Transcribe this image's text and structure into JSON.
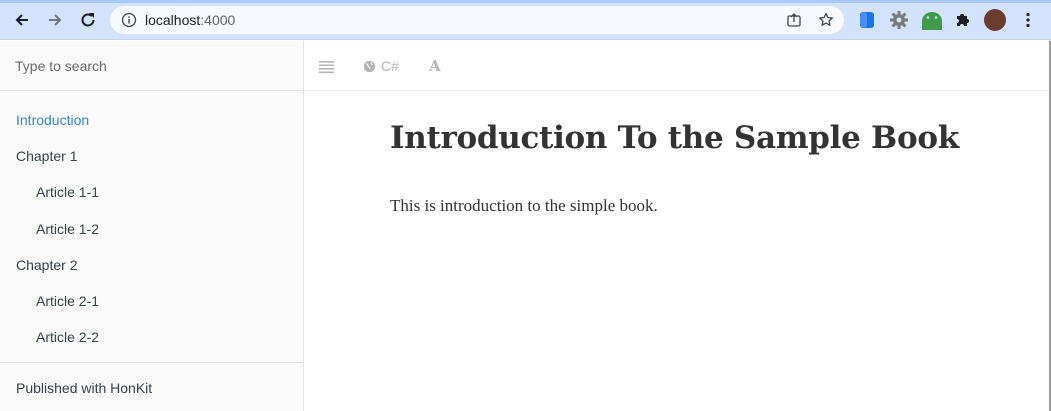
{
  "browser": {
    "url_host": "localhost",
    "url_port": ":4000",
    "icons": {
      "back": "arrow-left-icon",
      "forward": "arrow-right-icon",
      "reload": "reload-icon",
      "info": "info-icon",
      "share": "share-icon",
      "bookmark": "star-icon"
    },
    "extensions": [
      "blue-extension-icon",
      "gear-extension-icon",
      "android-extension-icon",
      "puzzle-icon",
      "profile-avatar",
      "kebab-menu-icon"
    ],
    "colors": {
      "chrome_bg": "#d3e3fd",
      "omnibox_bg": "#f6f9fe"
    }
  },
  "sidebar": {
    "search_placeholder": "Type to search",
    "items": [
      {
        "label": "Introduction",
        "level": 0,
        "active": true
      },
      {
        "label": "Chapter 1",
        "level": 0,
        "active": false
      },
      {
        "label": "Article 1-1",
        "level": 1,
        "active": false
      },
      {
        "label": "Article 1-2",
        "level": 1,
        "active": false
      },
      {
        "label": "Chapter 2",
        "level": 0,
        "active": false
      },
      {
        "label": "Article 2-1",
        "level": 1,
        "active": false
      },
      {
        "label": "Article 2-2",
        "level": 1,
        "active": false
      }
    ],
    "footer": "Published with HonKit",
    "colors": {
      "active": "#2d88c7",
      "text": "#364149"
    }
  },
  "header": {
    "toggle_icon": "hamburger-icon",
    "language_icon": "globe-icon",
    "language_label": "C#",
    "font_icon": "font-settings-icon",
    "font_label": "A"
  },
  "page": {
    "title": "Introduction To the Sample Book",
    "body": "This is introduction to the simple book."
  }
}
